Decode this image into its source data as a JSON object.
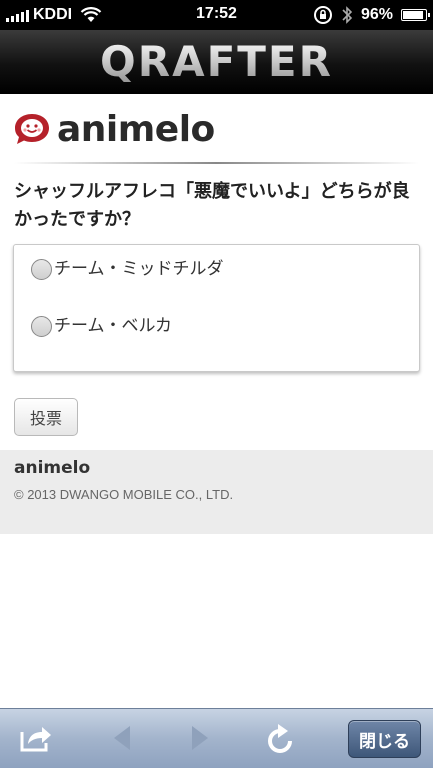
{
  "status_bar": {
    "carrier": "KDDI",
    "time": "17:52",
    "battery": "96%",
    "battery_level": 0.96,
    "icons": [
      "wifi-icon",
      "rotation-lock-icon",
      "bluetooth-icon",
      "battery-icon"
    ]
  },
  "header": {
    "title": "QRAFTER"
  },
  "logo": {
    "text": "animelo"
  },
  "question": "シャッフルアフレコ「悪魔でいいよ」どちらが良かったですか？",
  "options": [
    {
      "label": "チーム・ミッドチルダ",
      "selected": false
    },
    {
      "label": "チーム・ベルカ",
      "selected": false
    }
  ],
  "vote_button": "投票",
  "footer": {
    "brand": "animelo",
    "copyright": "© 2013 DWANGO MOBILE CO., LTD."
  },
  "toolbar": {
    "close_label": "閉じる",
    "icons": [
      "share-icon",
      "back-arrow-icon",
      "forward-arrow-icon",
      "reload-icon"
    ],
    "accent": "#3e5779"
  }
}
